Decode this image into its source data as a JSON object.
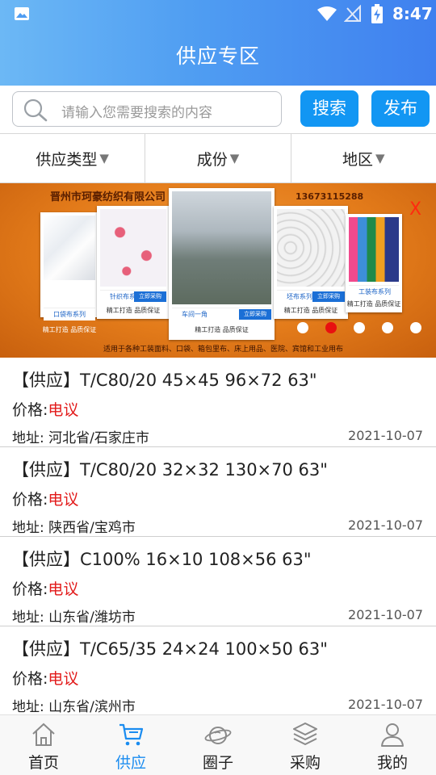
{
  "status_bar": {
    "time": "8:47"
  },
  "header": {
    "title": "供应专区"
  },
  "search": {
    "placeholder": "请输入您需要搜索的内容",
    "search_label": "搜索",
    "publish_label": "发布"
  },
  "filters": [
    {
      "label": "供应类型",
      "arrow": "▼"
    },
    {
      "label": "成份",
      "arrow": "▼"
    },
    {
      "label": "地区",
      "arrow": "▼"
    }
  ],
  "banner": {
    "company": "晋州市珂豪纺织有限公司",
    "phone": "13673115288",
    "close": "X",
    "footer": "适用于各种工装面料、口袋、箱包里布、床上用品、医院、宾馆和工业用布",
    "cards": [
      {
        "series": "口袋布系列",
        "slogan": "精工打造  品质保证",
        "buy": ""
      },
      {
        "series": "针织布系列",
        "slogan": "精工打造  品质保证",
        "buy": "立即采购"
      },
      {
        "series": "车间一角",
        "slogan": "精工打造  品质保证",
        "buy": "立即采购"
      },
      {
        "series": "坯布系列",
        "slogan": "精工打造  品质保证",
        "buy": "立即采购"
      },
      {
        "series": "工装布系列",
        "slogan": "精工打造  品质保证",
        "buy": ""
      }
    ],
    "active_dot_index": 1,
    "dot_count": 5
  },
  "listings": [
    {
      "title": "【供应】T/C80/20 45×45 96×72 63\"",
      "price_label": "价格:",
      "price": "电议",
      "address": "地址: 河北省/石家庄市",
      "date": "2021-10-07"
    },
    {
      "title": "【供应】T/C80/20 32×32 130×70 63\"",
      "price_label": "价格:",
      "price": "电议",
      "address": "地址: 陕西省/宝鸡市",
      "date": "2021-10-07"
    },
    {
      "title": "【供应】C100% 16×10 108×56 63\"",
      "price_label": "价格:",
      "price": "电议",
      "address": "地址: 山东省/潍坊市",
      "date": "2021-10-07"
    },
    {
      "title": "【供应】T/C65/35 24×24 100×50 63\"",
      "price_label": "价格:",
      "price": "电议",
      "address": "地址: 山东省/滨州市",
      "date": "2021-10-07"
    }
  ],
  "nav": [
    {
      "label": "首页",
      "icon": "home-icon",
      "active": false
    },
    {
      "label": "供应",
      "icon": "cart-icon",
      "active": true
    },
    {
      "label": "圈子",
      "icon": "planet-icon",
      "active": false
    },
    {
      "label": "采购",
      "icon": "layers-icon",
      "active": false
    },
    {
      "label": "我的",
      "icon": "user-icon",
      "active": false
    }
  ],
  "colors": {
    "accent": "#1296f3",
    "price": "#e21a1a",
    "nav_active": "#1a8cf0"
  }
}
